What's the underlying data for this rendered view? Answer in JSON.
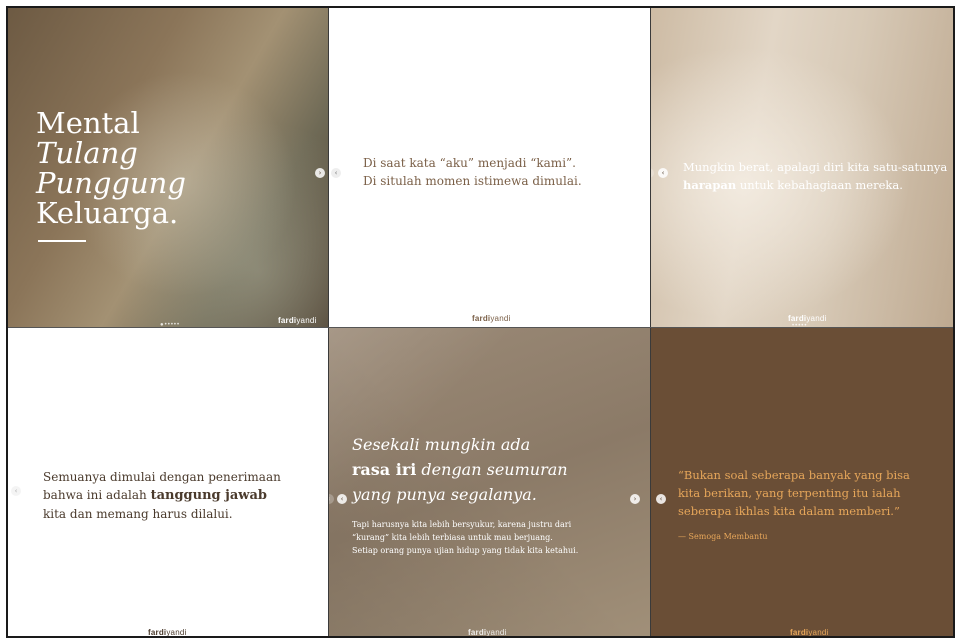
{
  "tile1": {
    "title_line1": "Mental",
    "title_line2": "Tulang",
    "title_line3": "Punggung",
    "title_line4": "Keluarga.",
    "brand_bold": "fardi",
    "brand_rest": "yandi",
    "dots": "●•••••"
  },
  "tile2": {
    "line1": "Di saat kata “aku” menjadi “kami”.",
    "line2": "Di situlah momen istimewa dimulai.",
    "brand_bold": "fardi",
    "brand_rest": "yandi"
  },
  "tile3": {
    "text_pre": "Mungkin berat, apalagi diri kita satu-satunya",
    "text_bold": "harapan",
    "text_post": "untuk kebahagiaan mereka.",
    "brand_bold": "fardi",
    "brand_rest": "yandi",
    "dots": "•••••"
  },
  "tile4": {
    "line1": "Semuanya dimulai dengan penerimaan",
    "line2_pre": "bahwa ini adalah",
    "line2_bold": "tanggung jawab",
    "line3": "kita dan memang harus dilalui.",
    "brand_bold": "fardi",
    "brand_rest": "yandi"
  },
  "tile5": {
    "head1": "Sesekali mungkin ada",
    "head2_bold": "rasa iri",
    "head2_rest": "dengan seumuran",
    "head3": "yang punya segalanya.",
    "sub1": "Tapi harusnya kita lebih bersyukur, karena justru dari",
    "sub2": "“kurang” kita lebih terbiasa untuk mau berjuang.",
    "sub3": "Setiap orang punya ujian hidup yang tidak kita ketahui.",
    "brand_bold": "fardi",
    "brand_rest": "yandi"
  },
  "tile6": {
    "quote1": "“Bukan soal seberapa banyak yang bisa",
    "quote2": "kita berikan, yang terpenting itu ialah",
    "quote3": "seberapa ikhlas kita dalam memberi.”",
    "attribution": "— Semoga Membantu",
    "brand_bold": "fardi",
    "brand_rest": "yandi"
  },
  "colors": {
    "quote_accent": "#e6a65a",
    "tile6_background": "#6a4e36",
    "text_brown": "#7a5f47"
  },
  "icons": {
    "carousel_prev": "chevron-left-icon",
    "carousel_next": "chevron-right-icon"
  }
}
